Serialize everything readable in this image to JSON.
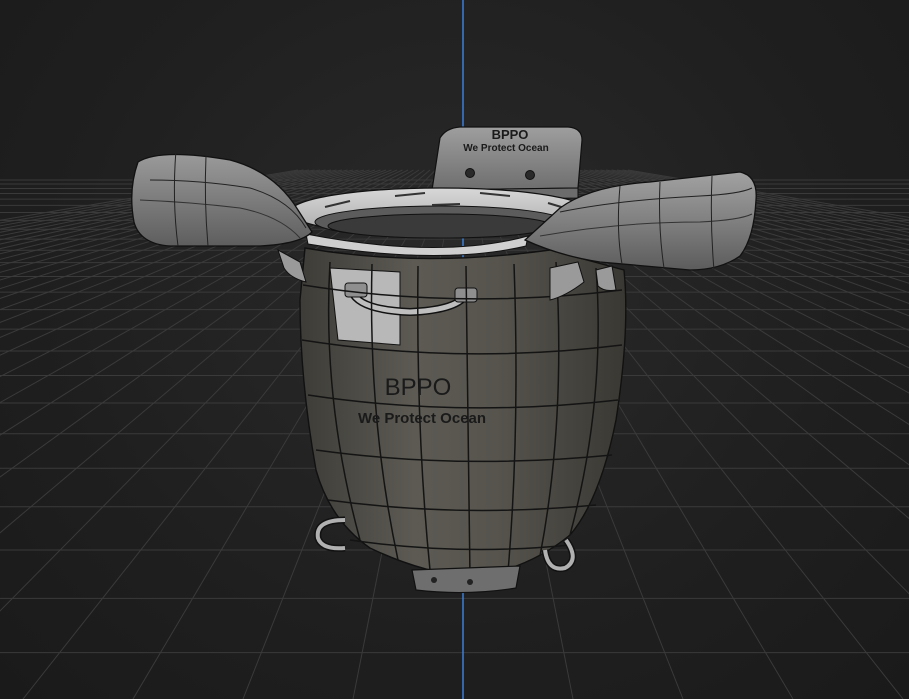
{
  "viewport": {
    "background": "#1e1e1e",
    "grid_color": "#3a3a3a",
    "axis_color": "#3b7fd6"
  },
  "model": {
    "body_brand": "BPPO",
    "body_slogan": "We Protect Ocean",
    "back_brand": "BPPO",
    "back_slogan": "We Protect Ocean",
    "shell_color": "#5a5750",
    "part_color": "#8a8a8a",
    "edge_color": "#111111"
  }
}
